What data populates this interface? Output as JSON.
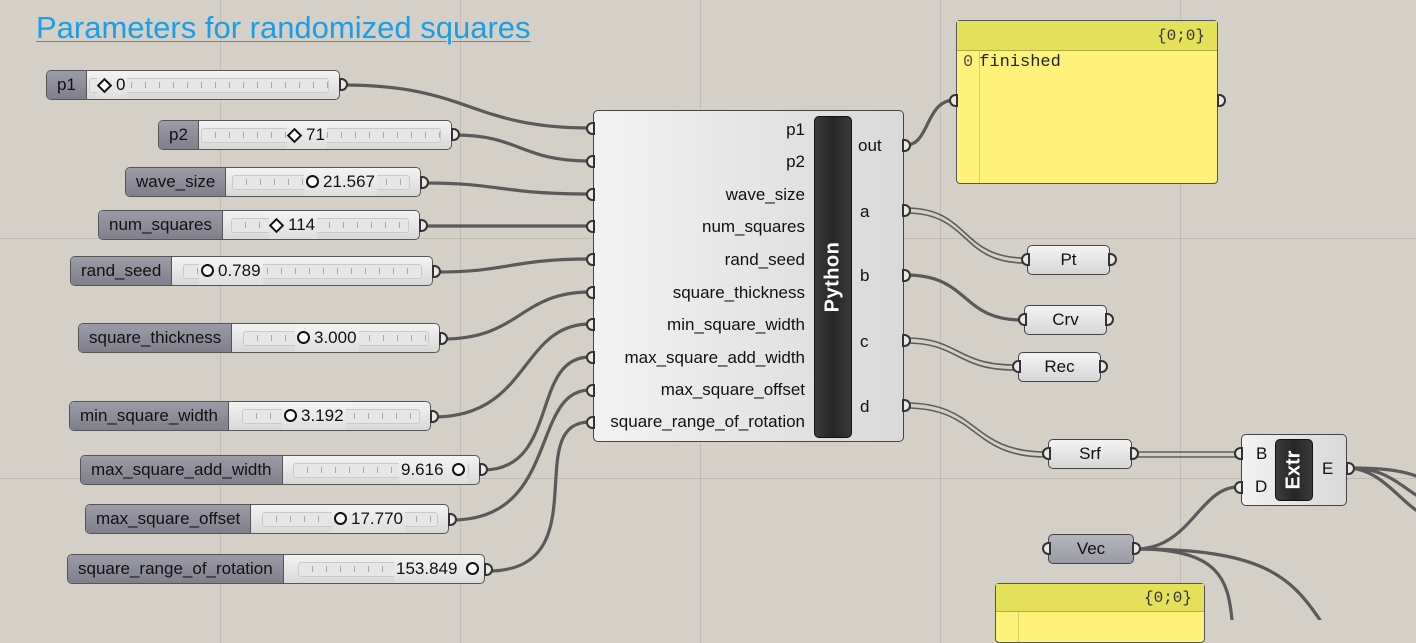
{
  "title": "Parameters for randomized squares",
  "sliders": [
    {
      "label": "p1",
      "value": "0"
    },
    {
      "label": "p2",
      "value": "71"
    },
    {
      "label": "wave_size",
      "value": "21.567"
    },
    {
      "label": "num_squares",
      "value": "114"
    },
    {
      "label": "rand_seed",
      "value": "0.789"
    },
    {
      "label": "square_thickness",
      "value": "3.000"
    },
    {
      "label": "min_square_width",
      "value": "3.192"
    },
    {
      "label": "max_square_add_width",
      "value": "9.616"
    },
    {
      "label": "max_square_offset",
      "value": "17.770"
    },
    {
      "label": "square_range_of_rotation",
      "value": "153.849"
    }
  ],
  "python": {
    "name": "Python",
    "inputs": [
      "p1",
      "p2",
      "wave_size",
      "num_squares",
      "rand_seed",
      "square_thickness",
      "min_square_width",
      "max_square_add_width",
      "max_square_offset",
      "square_range_of_rotation"
    ],
    "outputs": [
      "out",
      "a",
      "b",
      "c",
      "d"
    ]
  },
  "params": {
    "pt": "Pt",
    "crv": "Crv",
    "rec": "Rec",
    "srf": "Srf",
    "vec": "Vec"
  },
  "extrude": {
    "name": "Extr",
    "in_b": "B",
    "in_d": "D",
    "out_e": "E"
  },
  "panel_top": {
    "path": "{0;0}",
    "index": "0",
    "value": "finished"
  },
  "panel_bottom": {
    "path": "{0;0}"
  }
}
